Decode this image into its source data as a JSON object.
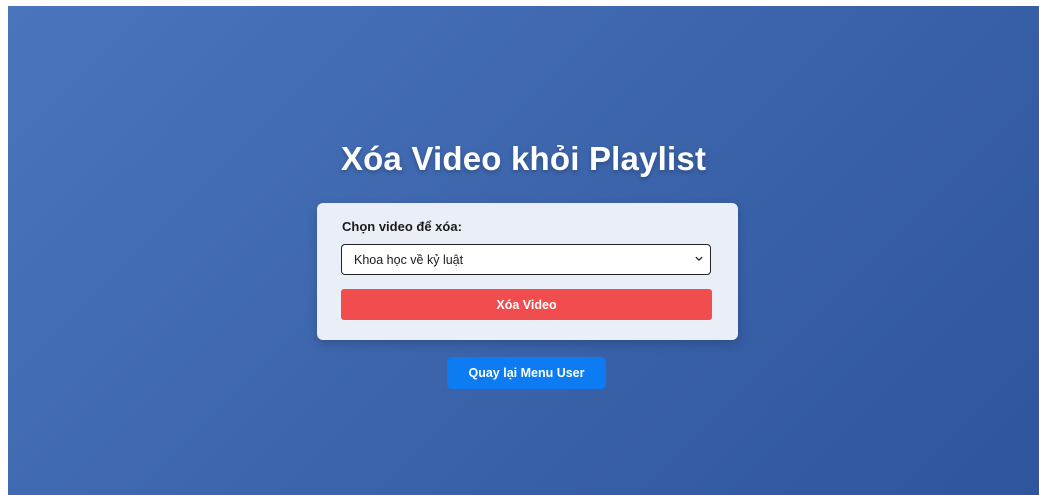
{
  "page": {
    "title": "Xóa Video khỏi Playlist"
  },
  "form": {
    "select_label": "Chọn video để xóa:",
    "selected_video": "Khoa học về kỷ luật",
    "delete_button_label": "Xóa Video"
  },
  "navigation": {
    "back_button_label": "Quay lại Menu User"
  },
  "icons": {
    "select_arrow": "chevron-down-icon"
  },
  "colors": {
    "background_start": "#4a75bd",
    "background_end": "#2f559c",
    "card_background": "#e9eef7",
    "delete_button": "#f14d4f",
    "back_button": "#0d7bf2"
  }
}
